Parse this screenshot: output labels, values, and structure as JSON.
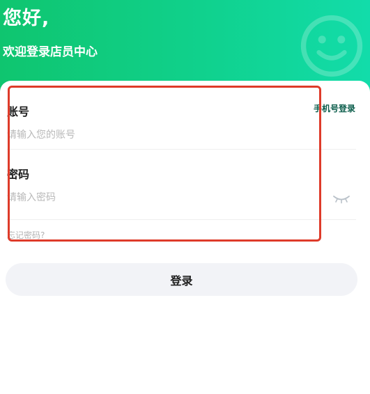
{
  "header": {
    "greeting": "您好,",
    "welcome": "欢迎登录店员中心",
    "decoration_icon": "smiley-face-icon"
  },
  "form": {
    "account_label": "账号",
    "account_placeholder": "请输入您的账号",
    "phone_login_link": "手机号登录",
    "password_label": "密码",
    "password_placeholder": "请输入密码",
    "password_toggle_icon": "eye-closed-icon",
    "forgot_password": "忘记密码?"
  },
  "actions": {
    "login_button": "登录"
  },
  "colors": {
    "header_gradient_start": "#0fc56f",
    "header_gradient_end": "#12dcaa",
    "link_color": "#0a5c4a",
    "highlight_border": "#de3b2a",
    "button_bg": "#f2f3f7"
  }
}
